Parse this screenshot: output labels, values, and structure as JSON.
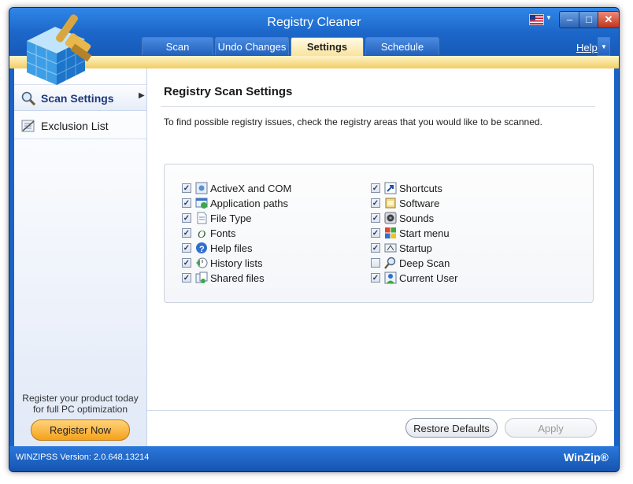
{
  "window": {
    "title": "Registry Cleaner"
  },
  "tabs": [
    {
      "label": "Scan"
    },
    {
      "label": "Undo Changes"
    },
    {
      "label": "Settings"
    },
    {
      "label": "Schedule"
    }
  ],
  "help": {
    "label": "Help"
  },
  "sidebar": {
    "items": [
      {
        "label": "Scan Settings"
      },
      {
        "label": "Exclusion List"
      }
    ],
    "promo_line1": "Register your product today",
    "promo_line2": "for full PC optimization",
    "register_label": "Register Now"
  },
  "content": {
    "heading": "Registry Scan Settings",
    "description": "To find possible registry issues, check the registry areas that you would like to be scanned.",
    "options_left": [
      {
        "label": "ActiveX and COM",
        "checked": true,
        "icon": "activex-icon"
      },
      {
        "label": "Application paths",
        "checked": true,
        "icon": "app-paths-icon"
      },
      {
        "label": "File Type",
        "checked": true,
        "icon": "file-type-icon"
      },
      {
        "label": "Fonts",
        "checked": true,
        "icon": "fonts-icon"
      },
      {
        "label": "Help files",
        "checked": true,
        "icon": "help-files-icon"
      },
      {
        "label": "History lists",
        "checked": true,
        "icon": "history-icon"
      },
      {
        "label": "Shared files",
        "checked": true,
        "icon": "shared-files-icon"
      }
    ],
    "options_right": [
      {
        "label": "Shortcuts",
        "checked": true,
        "icon": "shortcut-icon"
      },
      {
        "label": "Software",
        "checked": true,
        "icon": "software-icon"
      },
      {
        "label": "Sounds",
        "checked": true,
        "icon": "sounds-icon"
      },
      {
        "label": "Start menu",
        "checked": true,
        "icon": "start-menu-icon"
      },
      {
        "label": "Startup",
        "checked": true,
        "icon": "startup-icon"
      },
      {
        "label": "Deep Scan",
        "checked": false,
        "icon": "deep-scan-icon"
      },
      {
        "label": "Current User",
        "checked": true,
        "icon": "current-user-icon"
      }
    ]
  },
  "buttons": {
    "restore_defaults": "Restore Defaults",
    "apply": "Apply"
  },
  "status": {
    "version": "WINZIPSS Version: 2.0.648.13214",
    "brand": "WinZip®"
  },
  "colors": {
    "titlebar": "#1c67c9",
    "accent_gold": "#f2cd63",
    "active_tab": "#f9e29a"
  }
}
